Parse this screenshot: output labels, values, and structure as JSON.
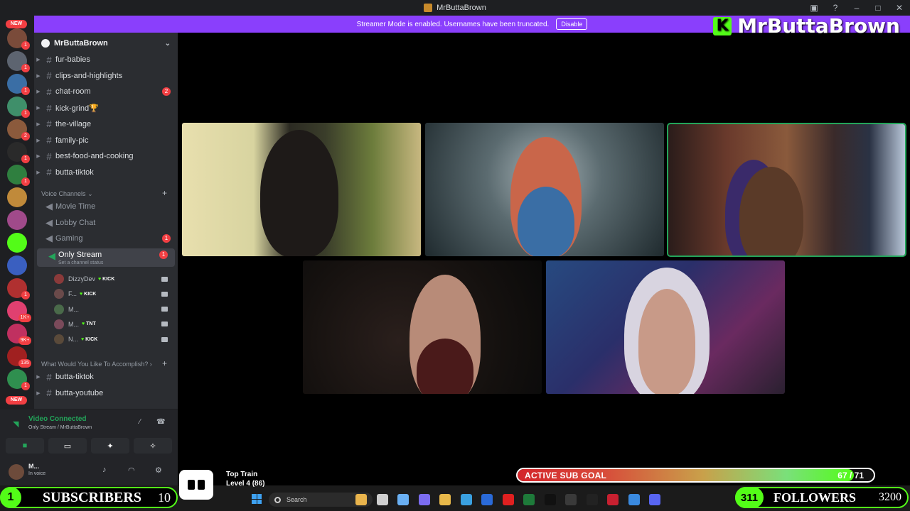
{
  "window": {
    "title": "MrButtaBrown"
  },
  "banner": {
    "text": "Streamer Mode is enabled. Usernames have been truncated.",
    "button": "Disable"
  },
  "brand": {
    "logo_letter": "K",
    "name": "MrButtaBrown"
  },
  "rail": {
    "new_label_top": "NEW",
    "new_label_bottom": "NEW",
    "servers": [
      {
        "color": "#7a4b3a",
        "badge": "1"
      },
      {
        "color": "#5d6470",
        "badge": "1"
      },
      {
        "color": "#3a6ea5",
        "badge": "1"
      },
      {
        "color": "#3f8f6a",
        "badge": "1"
      },
      {
        "color": "#8b5a3c",
        "badge": "2"
      },
      {
        "color": "#2a2a2a",
        "badge": "1"
      },
      {
        "color": "#2f7f3f",
        "badge": "1"
      },
      {
        "color": "#c08a3a",
        "badge": ""
      },
      {
        "color": "#a04a8a",
        "badge": ""
      },
      {
        "color": "#53fc18",
        "badge": ""
      },
      {
        "color": "#3a5fc0",
        "badge": ""
      },
      {
        "color": "#b03030",
        "badge": "1"
      },
      {
        "color": "#e04070",
        "badge": "1K+"
      },
      {
        "color": "#c03060",
        "badge": "9K+"
      },
      {
        "color": "#a02020",
        "badge": "135"
      },
      {
        "color": "#2f8f4f",
        "badge": "1"
      }
    ]
  },
  "sidebar": {
    "guild_name": "MrButtaBrown",
    "text_channels": [
      {
        "name": "fur-babies",
        "mention": ""
      },
      {
        "name": "clips-and-highlights",
        "mention": ""
      },
      {
        "name": "chat-room",
        "mention": "2"
      },
      {
        "name": "kick-grind🏆",
        "mention": ""
      },
      {
        "name": "the-village",
        "mention": ""
      },
      {
        "name": "family-pic",
        "mention": ""
      },
      {
        "name": "best-food-and-cooking",
        "mention": ""
      },
      {
        "name": "butta-tiktok",
        "mention": ""
      }
    ],
    "voice_category": "Voice Channels",
    "voice_channels": [
      {
        "name": "Movie Time",
        "mention": ""
      },
      {
        "name": "Lobby Chat",
        "mention": ""
      },
      {
        "name": "Gaming",
        "mention": "1"
      }
    ],
    "active_voice": {
      "name": "Only Stream",
      "mention": "1",
      "status": "Set a channel status"
    },
    "members": [
      {
        "name": "DizzyDev",
        "tag": "KICK",
        "color": "#8a3a3a"
      },
      {
        "name": "F...",
        "tag": "KICK",
        "color": "#6a4a4a"
      },
      {
        "name": "M...",
        "tag": "",
        "color": "#4a6a4a"
      },
      {
        "name": "M...",
        "tag": "TNT",
        "color": "#7a4a5a"
      },
      {
        "name": "N...",
        "tag": "KICK",
        "color": "#5a4a3a"
      }
    ],
    "category2": "What Would You Like To Accomplish?",
    "bottom_channels": [
      {
        "name": "butta-tiktok"
      },
      {
        "name": "butta-youtube"
      }
    ]
  },
  "voice_panel": {
    "title": "Video Connected",
    "subtitle": "Only Stream / MrButtaBrown"
  },
  "user_panel": {
    "name": "M...",
    "status": "In voice"
  },
  "overlay": {
    "subs_count": "1",
    "subs_label": "SUBSCRIBERS",
    "subs_goal": "10",
    "train_title": "Top Train",
    "train_level": "Level 4 (86)",
    "subgoal_label": "ACTIVE SUB GOAL",
    "subgoal_count": "67 / 71",
    "subgoal_progress": 0.944,
    "followers_count": "311",
    "followers_label": "FOLLOWERS",
    "followers_goal": "3200"
  },
  "taskbar": {
    "search_placeholder": "Search"
  }
}
